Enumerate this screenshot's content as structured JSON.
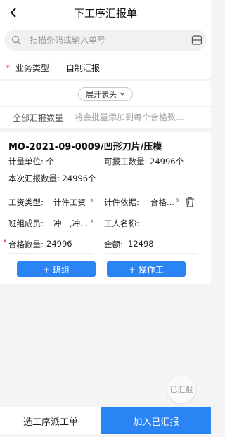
{
  "header": {
    "title": "下工序汇报单"
  },
  "search": {
    "placeholder": "扫描条码或输入单号"
  },
  "business": {
    "label": "业务类型",
    "value": "自制汇报"
  },
  "expand": {
    "label": "展开表头"
  },
  "batch": {
    "label": "全部汇报数量",
    "placeholder": "将会批量添加到每个合格数..."
  },
  "card": {
    "mo_title": "MO-2021-09-0009/凹形刀片/压模",
    "unit_label": "计量单位: 个",
    "reportable_label": "可报工数量: 24996个",
    "this_report_label": "本次汇报数量: 24996个",
    "wage_type_label": "工资类型:",
    "wage_type_value": "计件工资",
    "piece_basis_label": "计件依据:",
    "piece_basis_value": "合格...",
    "team_label": "班组成员:",
    "team_value": "冲一,冲...",
    "worker_label": "工人名称:",
    "qualified_label": "合格数量:",
    "qualified_value": "24996",
    "amount_label": "金额:",
    "amount_value": "12498",
    "add_team_label": "+ 班组",
    "add_operator_label": "+ 操作工"
  },
  "fab": {
    "label": "已汇报"
  },
  "footer": {
    "left_label": "选工序派工单",
    "right_label": "加入已汇报"
  },
  "colors": {
    "accent": "#2a84f4",
    "required": "#e23a2e"
  },
  "icons": [
    "back-icon",
    "search-icon",
    "scan-icon",
    "chevron-down-icon",
    "chevron-right-icon",
    "trash-icon"
  ]
}
